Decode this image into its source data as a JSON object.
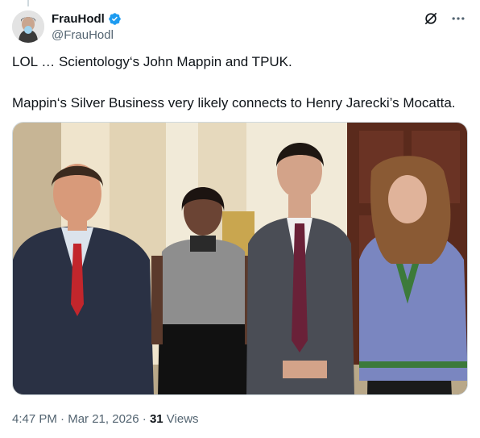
{
  "author": {
    "display_name": "FrauHodl",
    "handle": "@FrauHodl",
    "verified_icon": "verified-badge-icon"
  },
  "tweet": {
    "line1": "LOL … Scientology‘s John Mappin and TPUK.",
    "line2": "Mappin‘s Silver Business very likely connects to Henry Jarecki’s Mocatta."
  },
  "meta": {
    "time": "4:47 PM",
    "sep1": " · ",
    "date": "Mar 21, 2026",
    "sep2": " · ",
    "views_count": "31",
    "views_label": " Views"
  },
  "icons": {
    "grok": "grok-icon",
    "more": "more-options-icon"
  },
  "colors": {
    "accent": "#1d9bf0",
    "secondary_text": "#536471"
  }
}
